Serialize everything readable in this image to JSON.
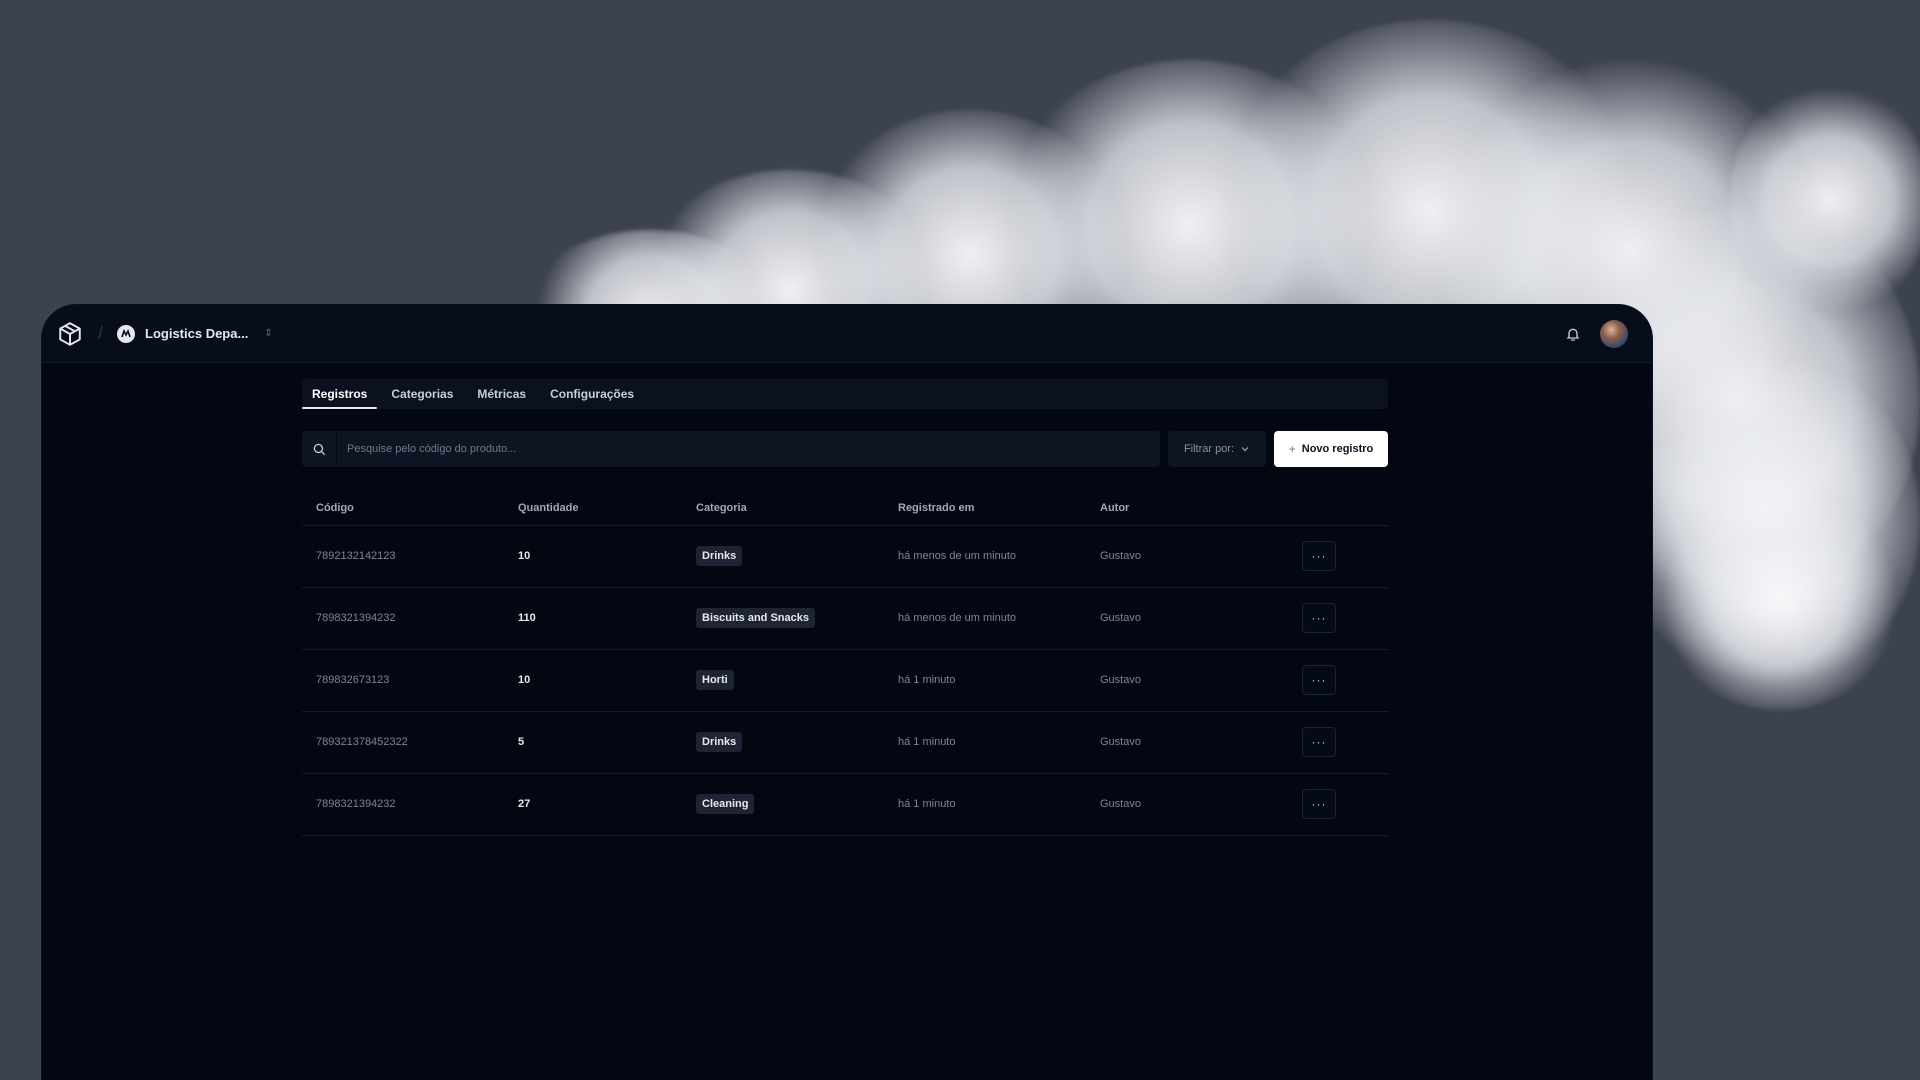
{
  "header": {
    "org_name": "Logistics Depa...",
    "separator": "/",
    "org_chevron": "⇕"
  },
  "icons": {
    "logo": "box-icon",
    "org": "org-logo-icon",
    "bell": "bell-icon",
    "search": "search-icon",
    "filter_chevron": "chevron-down-icon",
    "plus": "plus-icon",
    "more": "more-horizontal-icon"
  },
  "tabs": [
    {
      "label": "Registros",
      "active": true
    },
    {
      "label": "Categorias",
      "active": false
    },
    {
      "label": "Métricas",
      "active": false
    },
    {
      "label": "Configurações",
      "active": false
    }
  ],
  "toolbar": {
    "search_placeholder": "Pesquise pelo código do produto...",
    "search_value": "",
    "filter_label": "Filtrar por:",
    "new_label": "Novo registro",
    "new_plus": "+"
  },
  "table": {
    "columns": [
      "Código",
      "Quantidade",
      "Categoria",
      "Registrado em",
      "Autor"
    ],
    "more_label": "···",
    "rows": [
      {
        "code": "7892132142123",
        "qty": "10",
        "category": "Drinks",
        "registered": "há menos de um minuto",
        "author": "Gustavo"
      },
      {
        "code": "7898321394232",
        "qty": "110",
        "category": "Biscuits and Snacks",
        "registered": "há menos de um minuto",
        "author": "Gustavo"
      },
      {
        "code": "789832673123",
        "qty": "10",
        "category": "Horti",
        "registered": "há 1 minuto",
        "author": "Gustavo"
      },
      {
        "code": "789321378452322",
        "qty": "5",
        "category": "Drinks",
        "registered": "há 1 minuto",
        "author": "Gustavo"
      },
      {
        "code": "7898321394232",
        "qty": "27",
        "category": "Cleaning",
        "registered": "há 1 minuto",
        "author": "Gustavo"
      }
    ]
  },
  "colors": {
    "page_bg": "#3d4250",
    "window_bg": "#030712",
    "topbar_bg": "#070d1a",
    "badge_bg": "#1e2433",
    "primary_button_bg": "#ffffff"
  }
}
